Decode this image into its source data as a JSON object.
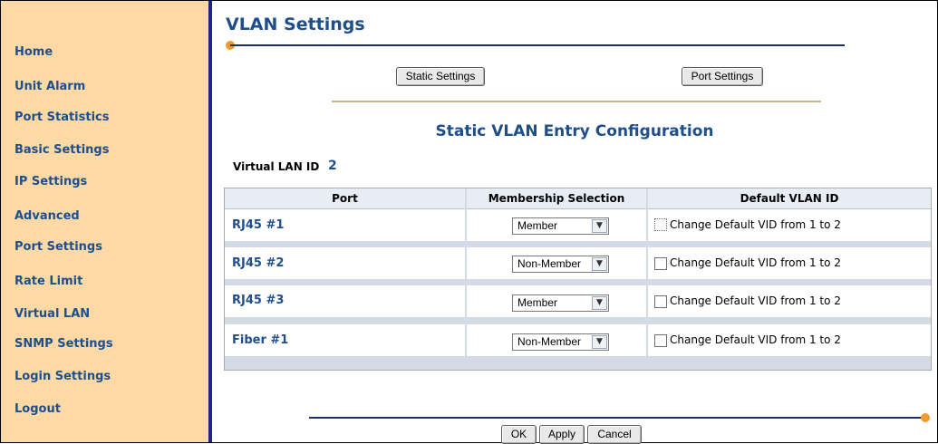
{
  "sidebar": {
    "items": [
      {
        "label": "Home"
      },
      {
        "label": "Unit Alarm"
      },
      {
        "label": "Port Statistics"
      },
      {
        "label": "Basic Settings"
      },
      {
        "label": "IP Settings"
      },
      {
        "label": "Advanced"
      },
      {
        "label": "Port Settings"
      },
      {
        "label": "Rate Limit"
      },
      {
        "label": "Virtual LAN"
      },
      {
        "label": "SNMP Settings"
      },
      {
        "label": "Login Settings"
      },
      {
        "label": "Logout"
      }
    ]
  },
  "page": {
    "title": "VLAN Settings",
    "subtitle": "Static VLAN Entry Configuration",
    "static_settings_label": "Static Settings",
    "port_settings_label": "Port Settings",
    "vlan_id_label": "Virtual LAN ID",
    "vlan_id_value": "2"
  },
  "table": {
    "headers": [
      "Port",
      "Membership Selection",
      "Default VLAN ID"
    ],
    "rows": [
      {
        "port": "RJ45 #1",
        "membership": "Member",
        "default_vid": "Change Default VID from 1 to 2",
        "checked": false
      },
      {
        "port": "RJ45 #2",
        "membership": "Non-Member",
        "default_vid": "Change Default VID from 1 to 2",
        "checked": false
      },
      {
        "port": "RJ45 #3",
        "membership": "Member",
        "default_vid": "Change Default VID from 1 to 2",
        "checked": false
      },
      {
        "port": "Fiber #1",
        "membership": "Non-Member",
        "default_vid": "Change Default VID from 1 to 2",
        "checked": false
      }
    ]
  },
  "footer": {
    "ok_label": "OK",
    "apply_label": "Apply",
    "cancel_label": "Cancel"
  },
  "colors": {
    "sidebar_bg": "#fcd9a5",
    "accent_blue": "#1e4f8c",
    "divider_navy": "#1a2a78",
    "dot_orange": "#f29a2e"
  }
}
